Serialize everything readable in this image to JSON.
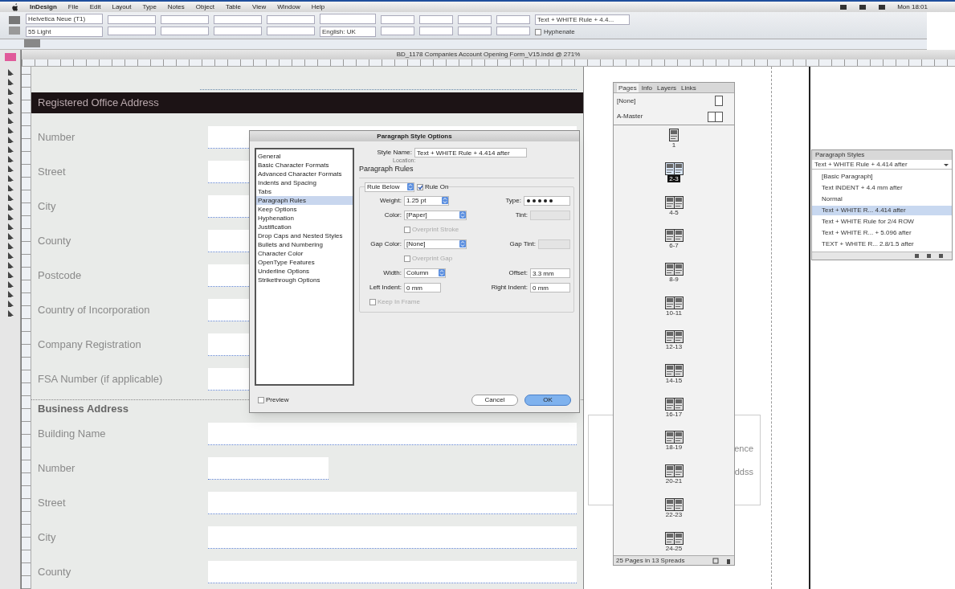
{
  "menu_bar": {
    "app": "InDesign",
    "items": [
      "File",
      "Edit",
      "Layout",
      "Type",
      "Notes",
      "Object",
      "Table",
      "View",
      "Window",
      "Help"
    ],
    "clock": "Mon 18:01"
  },
  "control_bar": {
    "font": "Helvetica Neue (T1)",
    "font_style": "55 Light",
    "language": "English: UK",
    "paragraph_style": "Text + WHITE Rule + 4.4...",
    "hyphenate": {
      "label": "Hyphenate",
      "checked": false
    }
  },
  "document": {
    "title": "BD_1178 Companies Account Opening Form_V15.indd @ 271%",
    "rows": [
      {
        "kind": "blank"
      },
      {
        "kind": "band",
        "label": "Registered Office Address"
      },
      {
        "kind": "field",
        "label": "Number"
      },
      {
        "kind": "field",
        "label": "Street"
      },
      {
        "kind": "field",
        "label": "City"
      },
      {
        "kind": "field",
        "label": "County"
      },
      {
        "kind": "field",
        "label": "Postcode"
      },
      {
        "kind": "field",
        "label": "Country of Incorporation"
      },
      {
        "kind": "field",
        "label": "Company Registration"
      },
      {
        "kind": "field",
        "label": "FSA Number (if applicable)"
      },
      {
        "kind": "heading",
        "label": "Business Address"
      },
      {
        "kind": "field",
        "label": "Building Name"
      },
      {
        "kind": "short",
        "label": "Number"
      },
      {
        "kind": "field",
        "label": "Street"
      },
      {
        "kind": "field",
        "label": "City"
      },
      {
        "kind": "field",
        "label": "County"
      }
    ],
    "side_frame_lines": [
      "ence",
      "ddss"
    ]
  },
  "dialog": {
    "title": "Paragraph Style Options",
    "categories": [
      {
        "label": "General",
        "selected": false
      },
      {
        "label": "Basic Character Formats",
        "selected": false
      },
      {
        "label": "Advanced Character Formats",
        "selected": false
      },
      {
        "label": "Indents and Spacing",
        "selected": false
      },
      {
        "label": "Tabs",
        "selected": false
      },
      {
        "label": "Paragraph Rules",
        "selected": true
      },
      {
        "label": "Keep Options",
        "selected": false
      },
      {
        "label": "Hyphenation",
        "selected": false
      },
      {
        "label": "Justification",
        "selected": false
      },
      {
        "label": "Drop Caps and Nested Styles",
        "selected": false
      },
      {
        "label": "Bullets and Numbering",
        "selected": false
      },
      {
        "label": "Character Color",
        "selected": false
      },
      {
        "label": "OpenType Features",
        "selected": false
      },
      {
        "label": "Underline Options",
        "selected": false
      },
      {
        "label": "Strikethrough Options",
        "selected": false
      }
    ],
    "style_name_label": "Style Name:",
    "style_name": "Text + WHITE Rule + 4.414 after",
    "location_label": "Location:",
    "section": "Paragraph Rules",
    "rule": "Rule Below",
    "rule_on": {
      "label": "Rule On",
      "checked": true
    },
    "weight_label": "Weight:",
    "weight": "1.25 pt",
    "type_label": "Type:",
    "color_label": "Color:",
    "color_name": "[Paper]",
    "tint_label": "Tint:",
    "overprint_stroke": {
      "label": "Overprint Stroke",
      "checked": false,
      "disabled": true
    },
    "gap_color_label": "Gap Color:",
    "gap_color_name": "[None]",
    "gap_tint_label": "Gap Tint:",
    "overprint_gap": {
      "label": "Overprint Gap",
      "checked": false,
      "disabled": true
    },
    "width_label": "Width:",
    "width": "Column",
    "offset_label": "Offset:",
    "offset": "3.3 mm",
    "left_indent_label": "Left Indent:",
    "left_indent": "0 mm",
    "right_indent_label": "Right Indent:",
    "right_indent": "0 mm",
    "keep_in_frame": {
      "label": "Keep In Frame",
      "checked": false,
      "disabled": true
    },
    "preview": {
      "label": "Preview",
      "checked": false
    },
    "buttons": [
      {
        "label": "Cancel",
        "default": false
      },
      {
        "label": "OK",
        "default": true
      }
    ]
  },
  "pages_panel": {
    "tabs": [
      {
        "label": "Pages",
        "selected": true
      },
      {
        "label": "Info",
        "selected": false
      },
      {
        "label": "Layers",
        "selected": false
      },
      {
        "label": "Links",
        "selected": false
      }
    ],
    "masters": [
      "[None]",
      "A-Master"
    ],
    "spreads": [
      {
        "label": "1",
        "kind": "single",
        "selected": false
      },
      {
        "label": "2-3",
        "kind": "spread",
        "selected": true
      },
      {
        "label": "4-5",
        "kind": "spread",
        "selected": false
      },
      {
        "label": "6-7",
        "kind": "spread",
        "selected": false
      },
      {
        "label": "8-9",
        "kind": "spread",
        "selected": false
      },
      {
        "label": "10-11",
        "kind": "spread",
        "selected": false
      },
      {
        "label": "12-13",
        "kind": "spread",
        "selected": false
      },
      {
        "label": "14-15",
        "kind": "spread",
        "selected": false
      },
      {
        "label": "16-17",
        "kind": "spread",
        "selected": false
      },
      {
        "label": "18-19",
        "kind": "spread",
        "selected": false
      },
      {
        "label": "20-21",
        "kind": "spread",
        "selected": false
      },
      {
        "label": "22-23",
        "kind": "spread",
        "selected": false
      },
      {
        "label": "24-25",
        "kind": "spread",
        "selected": false
      }
    ],
    "footer": "25 Pages in 13 Spreads"
  },
  "styles_panel": {
    "title": "Paragraph Styles",
    "current": "Text + WHITE Rule + 4.414 after",
    "items": [
      {
        "label": "[Basic Paragraph]",
        "selected": false
      },
      {
        "label": "Text INDENT + 4.4 mm after",
        "selected": false
      },
      {
        "label": "Normal",
        "selected": false
      },
      {
        "label": "Text + WHITE R... 4.414 after",
        "selected": true
      },
      {
        "label": "Text + WHITE Rule for 2/4 ROW",
        "selected": false
      },
      {
        "label": "Text + WHITE R... + 5.096 after",
        "selected": false
      },
      {
        "label": "TEXT + WHITE R... 2.8/1.5 after",
        "selected": false
      }
    ]
  }
}
